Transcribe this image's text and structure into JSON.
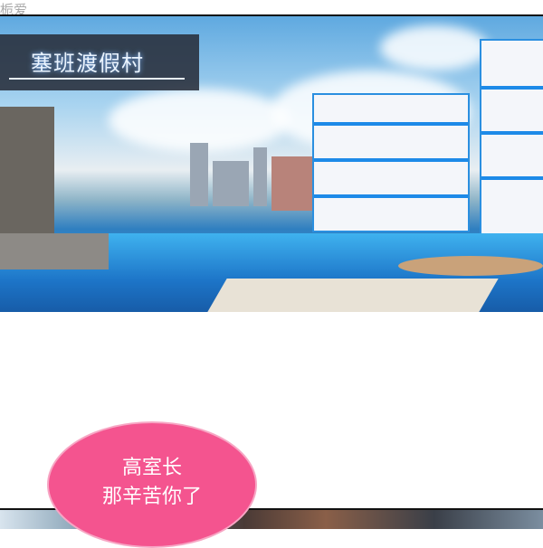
{
  "watermark": "栀爱",
  "panel1": {
    "caption": "塞班渡假村"
  },
  "bubble": {
    "line1": "高室长",
    "line2": "那辛苦你了",
    "color": "#f4548f"
  }
}
